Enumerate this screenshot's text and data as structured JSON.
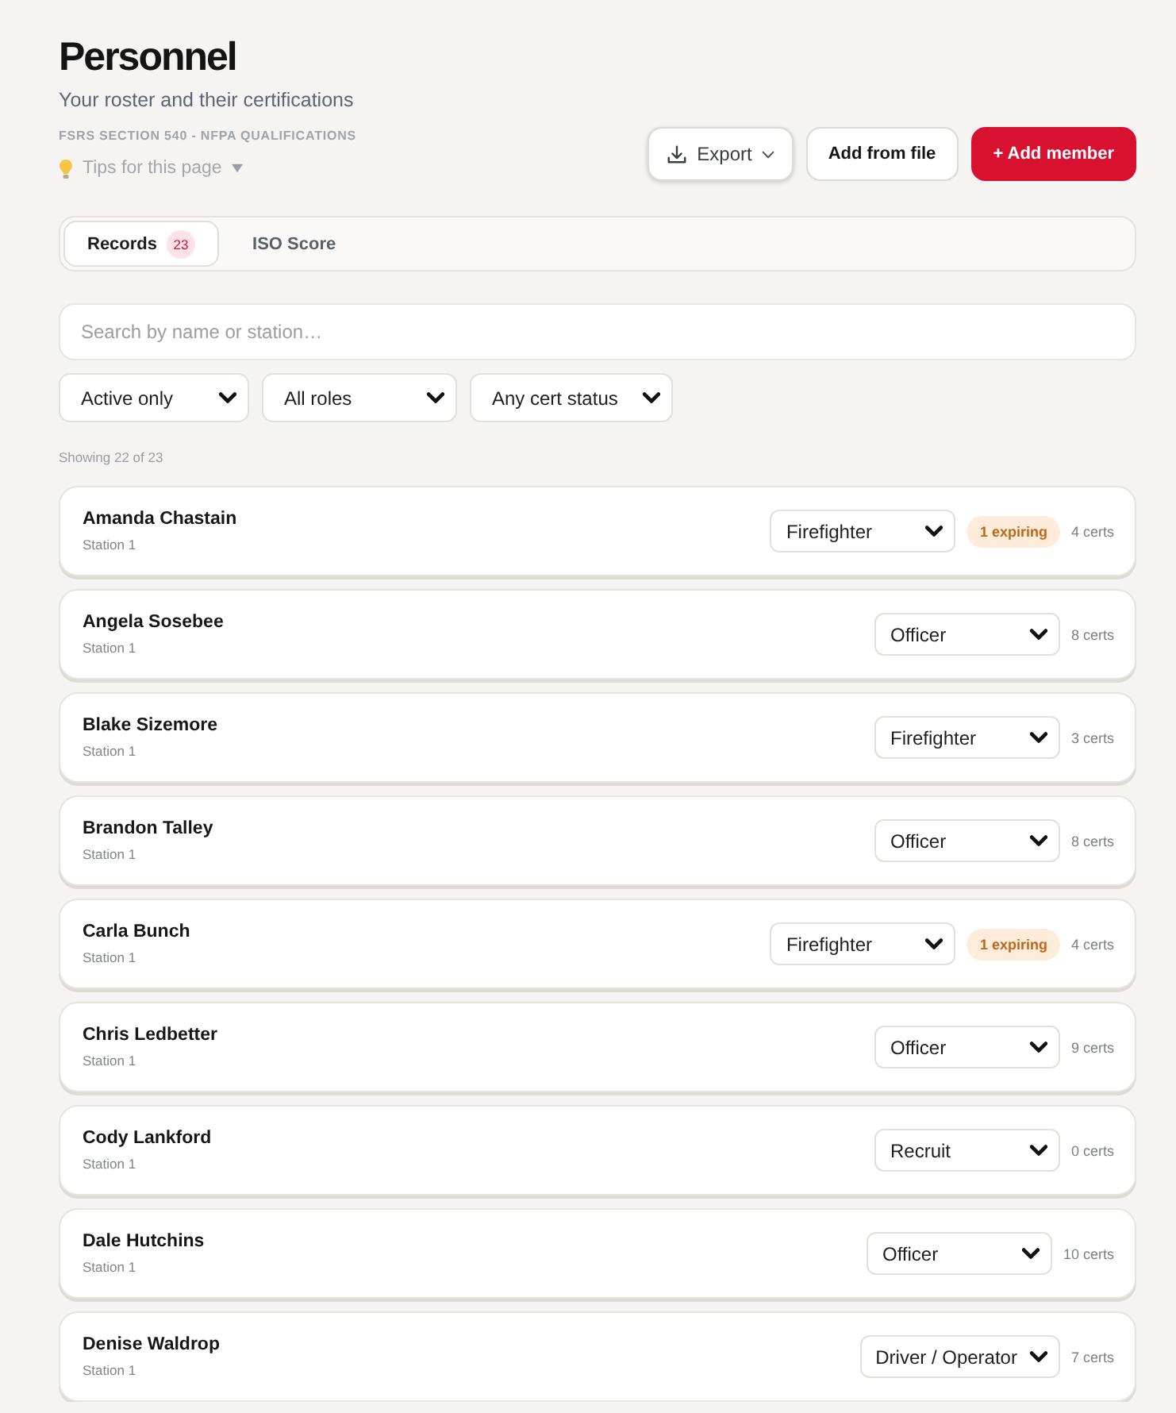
{
  "header": {
    "title": "Personnel",
    "subtitle": "Your roster and their certifications",
    "section_label": "FSRS SECTION 540 - NFPA QUALIFICATIONS",
    "tips": {
      "label": "Tips for this page",
      "expanded": false
    }
  },
  "actions": [
    {
      "kind": "export",
      "label": "Export"
    },
    {
      "kind": "secondary",
      "label": "Add from file"
    },
    {
      "kind": "primary",
      "label": "+ Add member"
    }
  ],
  "tabs": [
    {
      "label": "Records",
      "count": "23",
      "selected": true
    },
    {
      "label": "ISO Score",
      "selected": false
    }
  ],
  "search": {
    "placeholder": "Search by name or station…"
  },
  "filters": [
    {
      "value": "Active only"
    },
    {
      "value": "All roles"
    },
    {
      "value": "Any cert status"
    }
  ],
  "result_count": "Showing 22 of 23",
  "members": [
    {
      "name": "Amanda Chastain",
      "station": "Station 1",
      "role": "Firefighter",
      "expiring": "1 expiring",
      "certs": "4 certs"
    },
    {
      "name": "Angela Sosebee",
      "station": "Station 1",
      "role": "Officer",
      "certs": "8 certs"
    },
    {
      "name": "Blake Sizemore",
      "station": "Station 1",
      "role": "Firefighter",
      "certs": "3 certs"
    },
    {
      "name": "Brandon Talley",
      "station": "Station 1",
      "role": "Officer",
      "certs": "8 certs"
    },
    {
      "name": "Carla Bunch",
      "station": "Station 1",
      "role": "Firefighter",
      "expiring": "1 expiring",
      "certs": "4 certs"
    },
    {
      "name": "Chris Ledbetter",
      "station": "Station 1",
      "role": "Officer",
      "certs": "9 certs"
    },
    {
      "name": "Cody Lankford",
      "station": "Station 1",
      "role": "Recruit",
      "certs": "0 certs"
    },
    {
      "name": "Dale Hutchins",
      "station": "Station 1",
      "role": "Officer",
      "certs": "10 certs"
    },
    {
      "name": "Denise Waldrop",
      "station": "Station 1",
      "role": "Driver / Operator",
      "certs": "7 certs"
    }
  ]
}
